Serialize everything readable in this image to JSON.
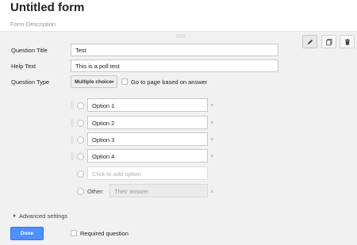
{
  "form": {
    "title": "Untitled form",
    "description": "Form Description"
  },
  "toolbar": {
    "icons": [
      "pencil-icon",
      "duplicate-icon",
      "trash-icon"
    ]
  },
  "question": {
    "title_label": "Question Title",
    "title_value": "Test",
    "help_label": "Help Text",
    "help_value": "This is a poll test",
    "type_label": "Question Type",
    "type_value": "Multiple choice",
    "goto_page_label": "Go to page based on answer",
    "goto_page_checked": false
  },
  "options": [
    {
      "label": "Option 1"
    },
    {
      "label": "Option 2"
    },
    {
      "label": "Option 3"
    },
    {
      "label": "Option 4"
    }
  ],
  "add_option_placeholder": "Click to add option",
  "other": {
    "label": "Other:",
    "placeholder": "Their answer"
  },
  "remove_symbol": "×",
  "advanced_settings_label": "Advanced settings",
  "done_label": "Done",
  "required_label": "Required question",
  "required_checked": false,
  "colors": {
    "primary_button": "#4d90fe",
    "editor_background": "#f1f1f1"
  }
}
